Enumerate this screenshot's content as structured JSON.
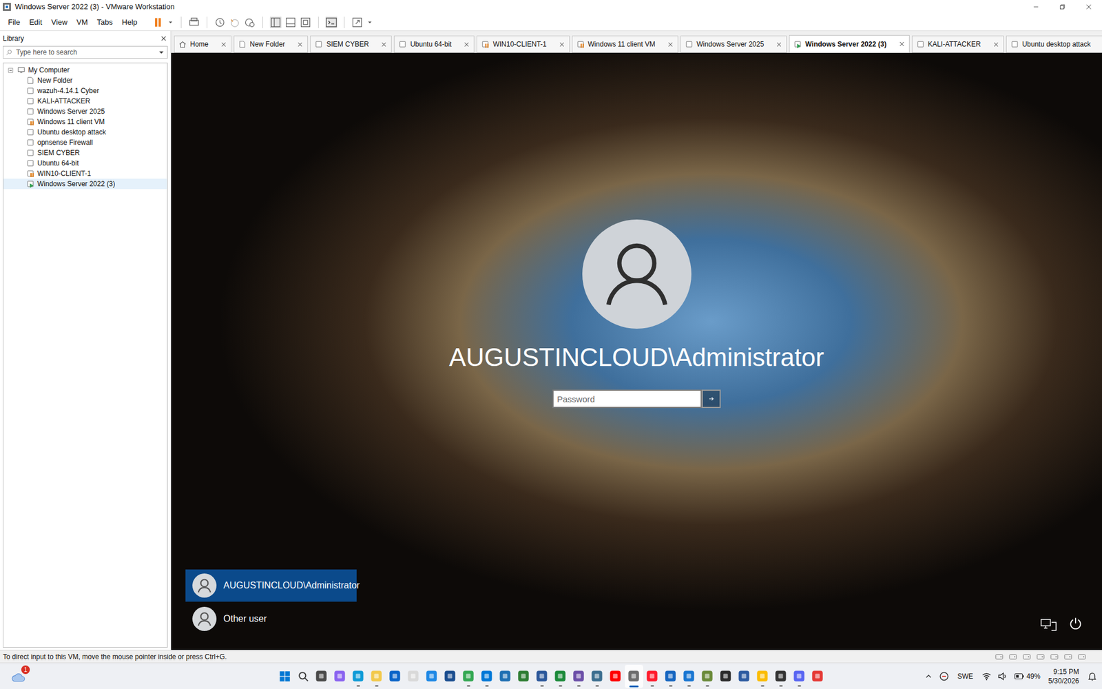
{
  "window": {
    "title": "Windows Server 2022 (3) - VMware Workstation"
  },
  "menu": [
    "File",
    "Edit",
    "View",
    "VM",
    "Tabs",
    "Help"
  ],
  "library": {
    "title": "Library",
    "search": {
      "placeholder": "Type here to search"
    },
    "root": {
      "label": "My Computer",
      "expanded": true
    },
    "items": [
      {
        "label": "New Folder",
        "kind": "folder",
        "state": "off",
        "selected": false
      },
      {
        "label": "wazuh-4.14.1 Cyber",
        "kind": "vm",
        "state": "off",
        "selected": false
      },
      {
        "label": "KALI-ATTACKER",
        "kind": "vm",
        "state": "off",
        "selected": false
      },
      {
        "label": "Windows Server 2025",
        "kind": "vm",
        "state": "off",
        "selected": false
      },
      {
        "label": "Windows 11 client VM",
        "kind": "vm",
        "state": "suspended",
        "selected": false
      },
      {
        "label": "Ubuntu desktop attack",
        "kind": "vm",
        "state": "off",
        "selected": false
      },
      {
        "label": "opnsense Firewall",
        "kind": "vm",
        "state": "off",
        "selected": false
      },
      {
        "label": "SIEM CYBER",
        "kind": "vm",
        "state": "off",
        "selected": false
      },
      {
        "label": "Ubuntu 64-bit",
        "kind": "vm",
        "state": "off",
        "selected": false
      },
      {
        "label": "WIN10-CLIENT-1",
        "kind": "vm",
        "state": "suspended",
        "selected": false
      },
      {
        "label": "Windows Server 2022 (3)",
        "kind": "vm",
        "state": "running",
        "selected": true
      }
    ]
  },
  "tabs": [
    {
      "label": "Home",
      "kind": "home",
      "state": "off",
      "selected": false
    },
    {
      "label": "New Folder",
      "kind": "folder",
      "state": "off",
      "selected": false
    },
    {
      "label": "SIEM CYBER",
      "kind": "vm",
      "state": "off",
      "selected": false
    },
    {
      "label": "Ubuntu 64-bit",
      "kind": "vm",
      "state": "off",
      "selected": false
    },
    {
      "label": "WIN10-CLIENT-1",
      "kind": "vm",
      "state": "suspended",
      "selected": false
    },
    {
      "label": "Windows 11 client VM",
      "kind": "vm",
      "state": "suspended",
      "selected": false
    },
    {
      "label": "Windows Server 2025",
      "kind": "vm",
      "state": "off",
      "selected": false
    },
    {
      "label": "Windows Server 2022 (3)",
      "kind": "vm",
      "state": "running",
      "selected": true
    },
    {
      "label": "KALI-ATTACKER",
      "kind": "vm",
      "state": "off",
      "selected": false
    },
    {
      "label": "Ubuntu desktop attack",
      "kind": "vm",
      "state": "off",
      "selected": false
    }
  ],
  "vm_screen": {
    "account": "AUGUSTINCLOUD\\Administrator",
    "password": {
      "placeholder": "Password"
    },
    "users": [
      {
        "label": "AUGUSTINCLOUD\\Administrator",
        "selected": true
      },
      {
        "label": "Other user",
        "selected": false
      }
    ]
  },
  "status_bar": {
    "text": "To direct input to this VM, move the mouse pointer inside or press Ctrl+G."
  },
  "taskbar": {
    "badge": "1",
    "apps": [
      {
        "kind": "start",
        "color": "#0078d4",
        "running": false,
        "active": false
      },
      {
        "kind": "search",
        "color": "#3b3b3b",
        "running": false,
        "active": false
      },
      {
        "kind": "app",
        "color": "#4a4a4a",
        "running": false,
        "active": false
      },
      {
        "kind": "app",
        "color": "#8a63f0",
        "running": false,
        "active": false
      },
      {
        "kind": "app",
        "color": "#0f9bd7",
        "running": true,
        "active": false
      },
      {
        "kind": "app",
        "color": "#f2c94c",
        "running": true,
        "active": false
      },
      {
        "kind": "app",
        "color": "#0a64c8",
        "running": false,
        "active": false
      },
      {
        "kind": "app",
        "color": "#d9d9d9",
        "running": false,
        "active": false
      },
      {
        "kind": "app",
        "color": "#1e88e5",
        "running": false,
        "active": false
      },
      {
        "kind": "app",
        "color": "#1a4d8f",
        "running": false,
        "active": false
      },
      {
        "kind": "app",
        "color": "#34a853",
        "running": true,
        "active": false
      },
      {
        "kind": "app",
        "color": "#0078d7",
        "running": true,
        "active": false
      },
      {
        "kind": "app",
        "color": "#1f6fb2",
        "running": false,
        "active": false
      },
      {
        "kind": "app",
        "color": "#2e7d32",
        "running": false,
        "active": false
      },
      {
        "kind": "app",
        "color": "#2b579a",
        "running": true,
        "active": false
      },
      {
        "kind": "app",
        "color": "#1b8a3a",
        "running": true,
        "active": false
      },
      {
        "kind": "app",
        "color": "#6b4fa8",
        "running": true,
        "active": false
      },
      {
        "kind": "app",
        "color": "#3b6e8f",
        "running": true,
        "active": false
      },
      {
        "kind": "app",
        "color": "#ff0000",
        "running": false,
        "active": false
      },
      {
        "kind": "app",
        "color": "#6d6d6d",
        "running": true,
        "active": true
      },
      {
        "kind": "app",
        "color": "#ff1b2d",
        "running": true,
        "active": false
      },
      {
        "kind": "app",
        "color": "#1565c0",
        "running": true,
        "active": false
      },
      {
        "kind": "app",
        "color": "#1976d2",
        "running": true,
        "active": false
      },
      {
        "kind": "app",
        "color": "#6a8a3a",
        "running": true,
        "active": false
      },
      {
        "kind": "app",
        "color": "#2b2b2b",
        "running": false,
        "active": false
      },
      {
        "kind": "app",
        "color": "#2c5aa0",
        "running": false,
        "active": false
      },
      {
        "kind": "app",
        "color": "#fbbc05",
        "running": true,
        "active": false
      },
      {
        "kind": "app",
        "color": "#333333",
        "running": true,
        "active": false
      },
      {
        "kind": "app",
        "color": "#5865f2",
        "running": true,
        "active": false
      },
      {
        "kind": "app",
        "color": "#e53935",
        "running": false,
        "active": false
      }
    ],
    "language": "SWE",
    "battery": "49%",
    "time": "9:15 PM",
    "date": "5/30/2026"
  }
}
